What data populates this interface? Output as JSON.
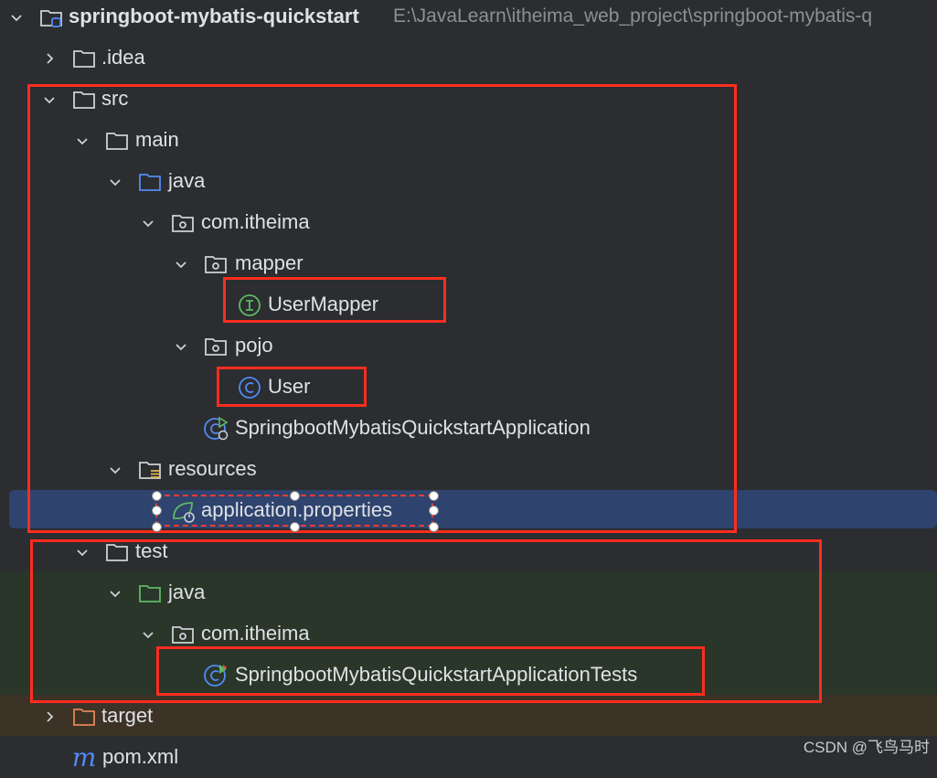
{
  "project": {
    "name": "springboot-mybatis-quickstart",
    "path": "E:\\JavaLearn\\itheima_web_project\\springboot-mybatis-q"
  },
  "tree": {
    "idea": ".idea",
    "src": "src",
    "main": "main",
    "main_java": "java",
    "main_pkg": "com.itheima",
    "mapper": "mapper",
    "user_mapper": "UserMapper",
    "pojo": "pojo",
    "user": "User",
    "app_class": "SpringbootMybatisQuickstartApplication",
    "resources": "resources",
    "app_properties": "application.properties",
    "test": "test",
    "test_java": "java",
    "test_pkg": "com.itheima",
    "test_class": "SpringbootMybatisQuickstartApplicationTests",
    "target": "target",
    "pom": "pom.xml"
  },
  "icons": {
    "module": "module-folder-icon",
    "folder": "folder-icon",
    "source_root": "source-root-folder-icon",
    "test_root": "test-root-folder-icon",
    "package": "package-icon",
    "interface": "interface-icon",
    "class": "class-icon",
    "spring_boot_app": "spring-boot-app-icon",
    "resources_root": "resources-root-folder-icon",
    "spring_properties": "spring-properties-icon",
    "excluded": "excluded-folder-icon",
    "maven": "maven-icon"
  },
  "colors": {
    "background": "#2b2d30",
    "selected_row": "#2e436e",
    "test_rows": "#293629",
    "target_row": "#3d3226",
    "annotation_red": "#ff2d1f",
    "source_blue": "#548af7",
    "test_green": "#5fb865",
    "excluded_orange": "#e08855"
  },
  "watermark": "CSDN @飞鸟马时"
}
